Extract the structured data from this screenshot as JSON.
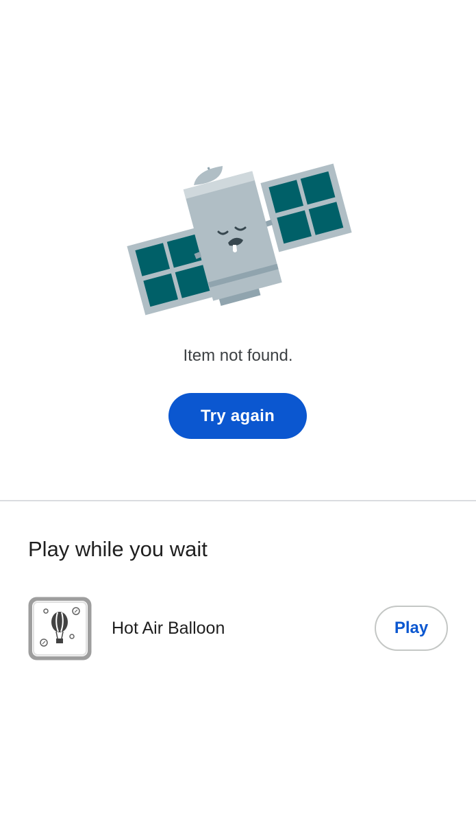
{
  "error": {
    "illustration": "sleeping-satellite-illustration",
    "message": "Item not found.",
    "retry_label": "Try again"
  },
  "games": {
    "title": "Play while you wait",
    "items": [
      {
        "name": "Hot Air Balloon",
        "icon": "hot-air-balloon-icon",
        "play_label": "Play"
      }
    ]
  },
  "colors": {
    "primary": "#0b57d0",
    "panel": "#006068",
    "satellite_body": "#b0bec5",
    "divider": "#dadce0"
  }
}
